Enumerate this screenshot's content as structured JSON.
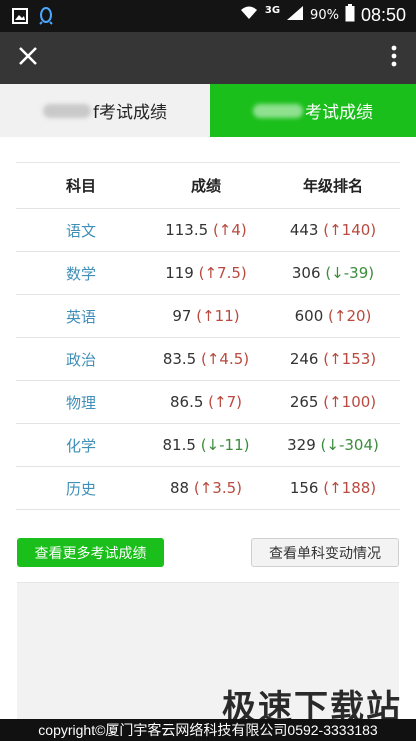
{
  "status_bar": {
    "network": "3G",
    "battery": "90%",
    "time": "08:50"
  },
  "tabs": [
    {
      "label": "f考试成绩",
      "active": false
    },
    {
      "label": "考试成绩",
      "active": true
    }
  ],
  "table": {
    "headers": [
      "科目",
      "成绩",
      "年级排名"
    ],
    "rows": [
      {
        "subject": "语文",
        "score": "113.5",
        "score_change": "(↑4)",
        "score_dir": "up",
        "rank": "443",
        "rank_change": "(↑140)",
        "rank_dir": "up"
      },
      {
        "subject": "数学",
        "score": "119",
        "score_change": "(↑7.5)",
        "score_dir": "up",
        "rank": "306",
        "rank_change": "(↓-39)",
        "rank_dir": "down"
      },
      {
        "subject": "英语",
        "score": "97",
        "score_change": "(↑11)",
        "score_dir": "up",
        "rank": "600",
        "rank_change": "(↑20)",
        "rank_dir": "up"
      },
      {
        "subject": "政治",
        "score": "83.5",
        "score_change": "(↑4.5)",
        "score_dir": "up",
        "rank": "246",
        "rank_change": "(↑153)",
        "rank_dir": "up"
      },
      {
        "subject": "物理",
        "score": "86.5",
        "score_change": "(↑7)",
        "score_dir": "up",
        "rank": "265",
        "rank_change": "(↑100)",
        "rank_dir": "up"
      },
      {
        "subject": "化学",
        "score": "81.5",
        "score_change": "(↓-11)",
        "score_dir": "down",
        "rank": "329",
        "rank_change": "(↓-304)",
        "rank_dir": "down"
      },
      {
        "subject": "历史",
        "score": "88",
        "score_change": "(↑3.5)",
        "score_dir": "up",
        "rank": "156",
        "rank_change": "(↑188)",
        "rank_dir": "up"
      }
    ]
  },
  "buttons": {
    "more_exams": "查看更多考试成绩",
    "subject_changes": "查看单科变动情况"
  },
  "watermark": "极速下载站",
  "footer": "copyright©厦门宇客云网络科技有限公司0592-3333183",
  "colors": {
    "accent_green": "#1bbf1b",
    "toolbar": "#363636",
    "up": "#b94a3f",
    "down": "#3c8c3c",
    "subject_link": "#3f8fb8"
  }
}
